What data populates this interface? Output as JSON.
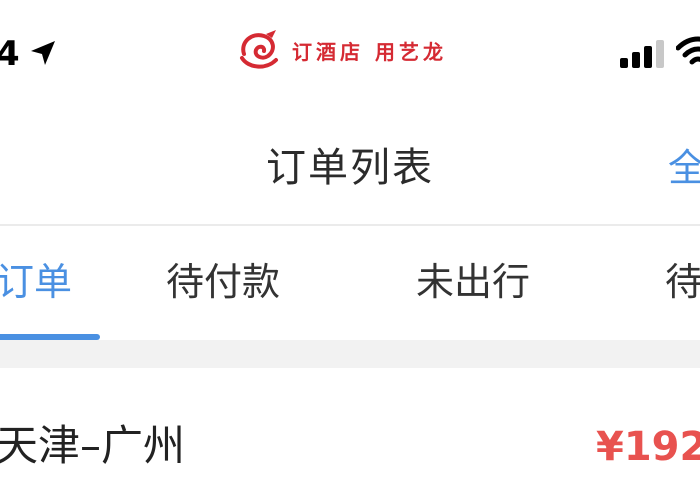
{
  "status_bar": {
    "time": "4",
    "brand_slogan": "订酒店 用艺龙",
    "icons": [
      "location-arrow-icon",
      "elong-logo-icon",
      "cellular-signal-icon",
      "wifi-icon"
    ]
  },
  "nav": {
    "title": "订单列表",
    "right_action": "全"
  },
  "tabs": [
    {
      "label": "订单",
      "active": true
    },
    {
      "label": "待付款",
      "active": false
    },
    {
      "label": "未出行",
      "active": false
    },
    {
      "label": "待",
      "active": false
    }
  ],
  "orders": [
    {
      "route": "天津–广州",
      "price": "¥192"
    }
  ],
  "colors": {
    "accent": "#4a90e2",
    "brand": "#d52a33",
    "price": "#e8524f",
    "divider": "#ebebeb",
    "section_gap": "#f2f2f2"
  }
}
